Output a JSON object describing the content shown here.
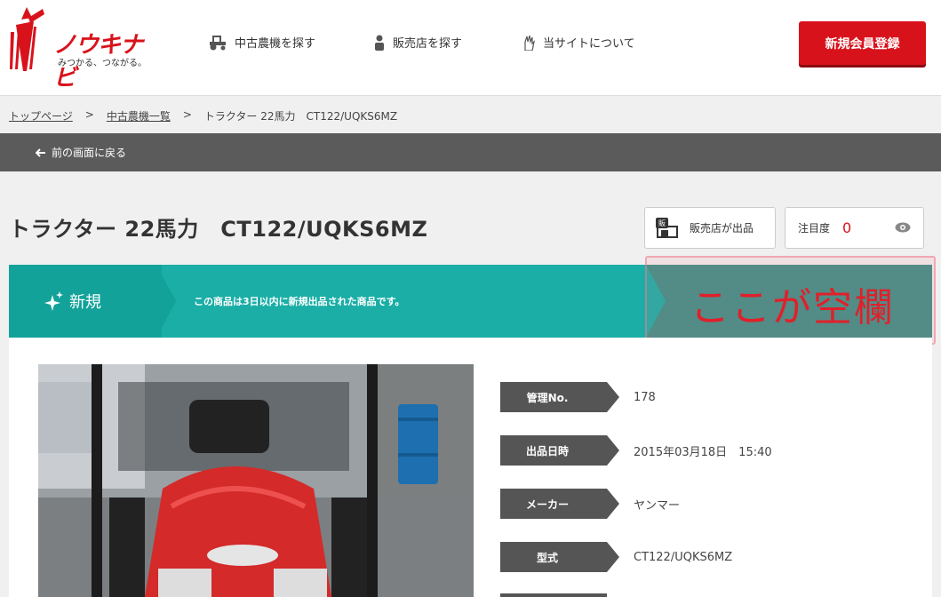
{
  "header": {
    "logo_text": "ノウキナビ",
    "logo_tagline": "みつかる、つながる。",
    "nav": [
      {
        "label": "中古農機を探す",
        "icon": "tractor-icon"
      },
      {
        "label": "販売店を探す",
        "icon": "person-icon"
      },
      {
        "label": "当サイトについて",
        "icon": "hand-icon"
      }
    ],
    "register_button": "新規会員登録"
  },
  "breadcrumb": {
    "items": [
      "トップページ",
      "中古農機一覧",
      "トラクター 22馬力　CT122/UQKS6MZ"
    ],
    "separator": ">"
  },
  "backbar": {
    "label": "前の画面に戻る"
  },
  "product": {
    "title": "トラクター 22馬力　CT122/UQKS6MZ",
    "dealer_badge": "販",
    "dealer_label": "販売店が出品",
    "attention_label": "注目度",
    "attention_count": "0"
  },
  "banner": {
    "label": "新規",
    "message": "この商品は3日以内に新規出品された商品です。",
    "color": "#1aaea6"
  },
  "annotation": {
    "text": "ここが空欄"
  },
  "specs": [
    {
      "label": "管理No.",
      "value": "178"
    },
    {
      "label": "出品日時",
      "value": "2015年03月18日　15:40"
    },
    {
      "label": "メーカー",
      "value": "ヤンマー"
    },
    {
      "label": "型式",
      "value": "CT122/UQKS6MZ"
    }
  ],
  "colors": {
    "brand_red": "#d8121b",
    "teal": "#1aaea6",
    "dark_gray": "#5b5b5b"
  }
}
